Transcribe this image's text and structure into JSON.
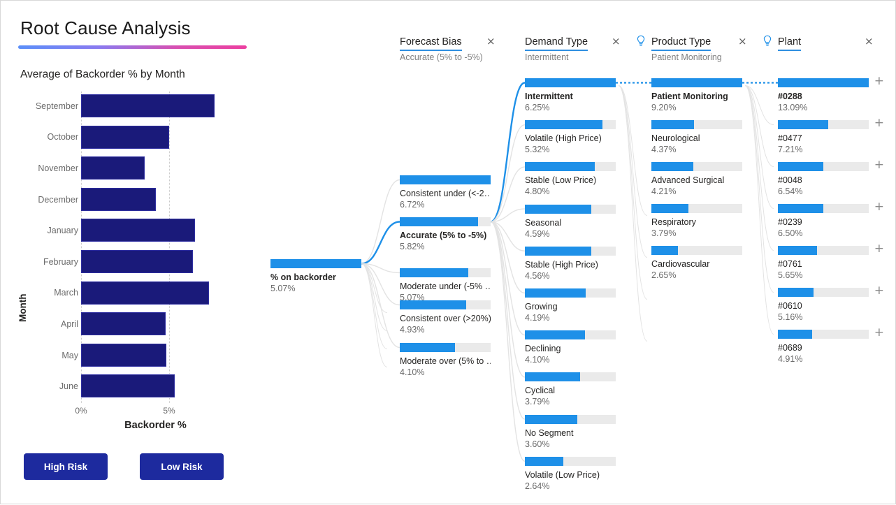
{
  "page": {
    "title": "Root Cause Analysis"
  },
  "chart_panel": {
    "chart_title": "Average of Backorder % by Month",
    "buttons": {
      "high_risk": "High Risk",
      "low_risk": "Low Risk"
    }
  },
  "chart_data": {
    "type": "bar",
    "orientation": "horizontal",
    "title": "Average of Backorder % by Month",
    "xlabel": "Backorder %",
    "ylabel": "Month",
    "categories": [
      "September",
      "October",
      "November",
      "December",
      "January",
      "February",
      "March",
      "April",
      "May",
      "June"
    ],
    "values": [
      7.58,
      5.0,
      3.61,
      4.25,
      6.47,
      6.35,
      7.26,
      4.8,
      4.84,
      5.32
    ],
    "xticks": [
      "0%",
      "5%"
    ],
    "xtick_values": [
      0,
      5
    ],
    "xlim": [
      0,
      8.45
    ],
    "grid": true,
    "legend": "none",
    "bar_color": "#1a1a7a"
  },
  "tree": {
    "accent_color": "#1e90e8",
    "track_color": "#eaeaea",
    "columns": [
      {
        "id": "forecast-bias",
        "title": "Forecast Bias",
        "subtitle": "Accurate (5% to -5%)",
        "has_bulb": false,
        "close_label": "×"
      },
      {
        "id": "demand-type",
        "title": "Demand Type",
        "subtitle": "Intermittent",
        "has_bulb": false,
        "close_label": "×"
      },
      {
        "id": "product-type",
        "title": "Product Type",
        "subtitle": "Patient Monitoring",
        "has_bulb": true,
        "close_label": "×"
      },
      {
        "id": "plant",
        "title": "Plant",
        "subtitle": "",
        "has_bulb": true,
        "close_label": "×"
      }
    ],
    "root": {
      "label": "% on backorder",
      "value": "5.07%",
      "fill_pct": 100,
      "selected": true
    },
    "forecast_bias_nodes": [
      {
        "label": "Consistent under (<-2…",
        "value": "6.72%",
        "fill_pct": 100,
        "selected": false
      },
      {
        "label": "Accurate (5% to -5%)",
        "value": "5.82%",
        "fill_pct": 86,
        "selected": true
      },
      {
        "label": "Moderate under (-5% …",
        "value": "5.07%",
        "fill_pct": 75,
        "selected": false
      },
      {
        "label": "Consistent over (>20%)",
        "value": "4.93%",
        "fill_pct": 73,
        "selected": false
      },
      {
        "label": "Moderate over (5% to …",
        "value": "4.10%",
        "fill_pct": 61,
        "selected": false
      }
    ],
    "demand_type_nodes": [
      {
        "label": "Intermittent",
        "value": "6.25%",
        "fill_pct": 100,
        "selected": true
      },
      {
        "label": "Volatile (High Price)",
        "value": "5.32%",
        "fill_pct": 85,
        "selected": false
      },
      {
        "label": "Stable (Low Price)",
        "value": "4.80%",
        "fill_pct": 77,
        "selected": false
      },
      {
        "label": "Seasonal",
        "value": "4.59%",
        "fill_pct": 73,
        "selected": false
      },
      {
        "label": "Stable (High Price)",
        "value": "4.56%",
        "fill_pct": 73,
        "selected": false
      },
      {
        "label": "Growing",
        "value": "4.19%",
        "fill_pct": 67,
        "selected": false
      },
      {
        "label": "Declining",
        "value": "4.10%",
        "fill_pct": 66,
        "selected": false
      },
      {
        "label": "Cyclical",
        "value": "3.79%",
        "fill_pct": 61,
        "selected": false
      },
      {
        "label": "No Segment",
        "value": "3.60%",
        "fill_pct": 58,
        "selected": false
      },
      {
        "label": "Volatile (Low Price)",
        "value": "2.64%",
        "fill_pct": 42,
        "selected": false
      }
    ],
    "product_type_nodes": [
      {
        "label": "Patient Monitoring",
        "value": "9.20%",
        "fill_pct": 100,
        "selected": true
      },
      {
        "label": "Neurological",
        "value": "4.37%",
        "fill_pct": 47,
        "selected": false
      },
      {
        "label": "Advanced Surgical",
        "value": "4.21%",
        "fill_pct": 46,
        "selected": false
      },
      {
        "label": "Respiratory",
        "value": "3.79%",
        "fill_pct": 41,
        "selected": false
      },
      {
        "label": "Cardiovascular",
        "value": "2.65%",
        "fill_pct": 29,
        "selected": false
      }
    ],
    "plant_nodes": [
      {
        "label": "#0288",
        "value": "13.09%",
        "fill_pct": 100,
        "selected": true,
        "expand": "+"
      },
      {
        "label": "#0477",
        "value": "7.21%",
        "fill_pct": 55,
        "selected": false,
        "expand": "+"
      },
      {
        "label": "#0048",
        "value": "6.54%",
        "fill_pct": 50,
        "selected": false,
        "expand": "+"
      },
      {
        "label": "#0239",
        "value": "6.50%",
        "fill_pct": 50,
        "selected": false,
        "expand": "+"
      },
      {
        "label": "#0761",
        "value": "5.65%",
        "fill_pct": 43,
        "selected": false,
        "expand": "+"
      },
      {
        "label": "#0610",
        "value": "5.16%",
        "fill_pct": 39,
        "selected": false,
        "expand": "+"
      },
      {
        "label": "#0689",
        "value": "4.91%",
        "fill_pct": 38,
        "selected": false,
        "expand": "+"
      }
    ]
  }
}
